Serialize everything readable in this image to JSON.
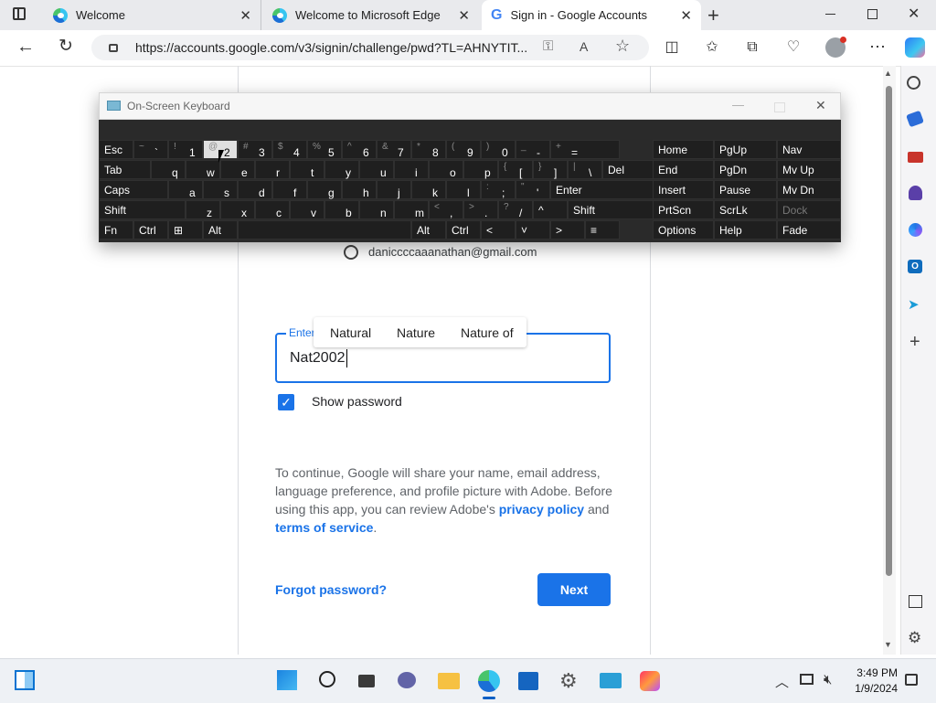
{
  "browser": {
    "tabs": [
      {
        "label": "Welcome",
        "icon": "edge-icon"
      },
      {
        "label": "Welcome to Microsoft Edge",
        "icon": "edge-icon"
      },
      {
        "label": "Sign in - Google Accounts",
        "icon": "google-icon",
        "active": true
      }
    ],
    "url": "https://accounts.google.com/v3/signin/challenge/pwd?TL=AHNYTIT..."
  },
  "osk": {
    "title": "On-Screen Keyboard",
    "rows": [
      [
        {
          "s": "",
          "m": "Esc"
        },
        {
          "s": "~",
          "m": "`"
        },
        {
          "s": "!",
          "m": "1"
        },
        {
          "s": "@",
          "m": "2"
        },
        {
          "s": "#",
          "m": "3"
        },
        {
          "s": "$",
          "m": "4"
        },
        {
          "s": "%",
          "m": "5"
        },
        {
          "s": "^",
          "m": "6"
        },
        {
          "s": "&",
          "m": "7"
        },
        {
          "s": "*",
          "m": "8"
        },
        {
          "s": "(",
          "m": "9"
        },
        {
          "s": ")",
          "m": "0"
        },
        {
          "s": "_",
          "m": "-"
        },
        {
          "s": "+",
          "m": "="
        }
      ],
      [
        {
          "m": "Tab"
        },
        {
          "m": "q"
        },
        {
          "m": "w"
        },
        {
          "m": "e"
        },
        {
          "m": "r"
        },
        {
          "m": "t"
        },
        {
          "m": "y"
        },
        {
          "m": "u"
        },
        {
          "m": "i"
        },
        {
          "m": "o"
        },
        {
          "m": "p"
        },
        {
          "s": "{",
          "m": "["
        },
        {
          "s": "}",
          "m": "]"
        },
        {
          "s": "|",
          "m": "\\"
        },
        {
          "m": "Del"
        }
      ],
      [
        {
          "m": "Caps"
        },
        {
          "m": "a"
        },
        {
          "m": "s"
        },
        {
          "m": "d"
        },
        {
          "m": "f"
        },
        {
          "m": "g"
        },
        {
          "m": "h"
        },
        {
          "m": "j"
        },
        {
          "m": "k"
        },
        {
          "m": "l"
        },
        {
          "s": ":",
          "m": ";"
        },
        {
          "s": "\"",
          "m": "'"
        },
        {
          "m": "Enter"
        }
      ],
      [
        {
          "m": "Shift"
        },
        {
          "m": "z"
        },
        {
          "m": "x"
        },
        {
          "m": "c"
        },
        {
          "m": "v"
        },
        {
          "m": "b"
        },
        {
          "m": "n"
        },
        {
          "m": "m"
        },
        {
          "s": "<",
          "m": ","
        },
        {
          "s": ">",
          "m": "."
        },
        {
          "s": "?",
          "m": "/"
        },
        {
          "m": "^"
        },
        {
          "m": "Shift"
        }
      ],
      [
        {
          "m": "Fn"
        },
        {
          "m": "Ctrl"
        },
        {
          "m": "⊞"
        },
        {
          "m": "Alt"
        },
        {
          "m": ""
        },
        {
          "m": "Alt"
        },
        {
          "m": "Ctrl"
        },
        {
          "m": "<"
        },
        {
          "m": "˅"
        },
        {
          "m": ">"
        },
        {
          "m": "≡"
        }
      ]
    ],
    "nav": [
      [
        "Home",
        "PgUp",
        "Nav"
      ],
      [
        "End",
        "PgDn",
        "Mv Up"
      ],
      [
        "Insert",
        "Pause",
        "Mv Dn"
      ],
      [
        "PrtScn",
        "ScrLk",
        "Dock"
      ],
      [
        "Options",
        "Help",
        "Fade"
      ]
    ]
  },
  "signin": {
    "email": "daniccccaaanathan@gmail.com",
    "field_label": "Enter",
    "password_value": "Nat2002",
    "suggestions": [
      "Natural",
      "Nature",
      "Nature of"
    ],
    "show_password": "Show password",
    "info_text": "To continue, Google will share your name, email address, language preference, and profile picture with Adobe. Before using this app, you can review Adobe's",
    "privacy_link": "privacy policy",
    "and": "and",
    "terms_link": "terms of service",
    "period": ".",
    "forgot": "Forgot password?",
    "next": "Next"
  },
  "taskbar": {
    "time": "3:49 PM",
    "date": "1/9/2024"
  }
}
